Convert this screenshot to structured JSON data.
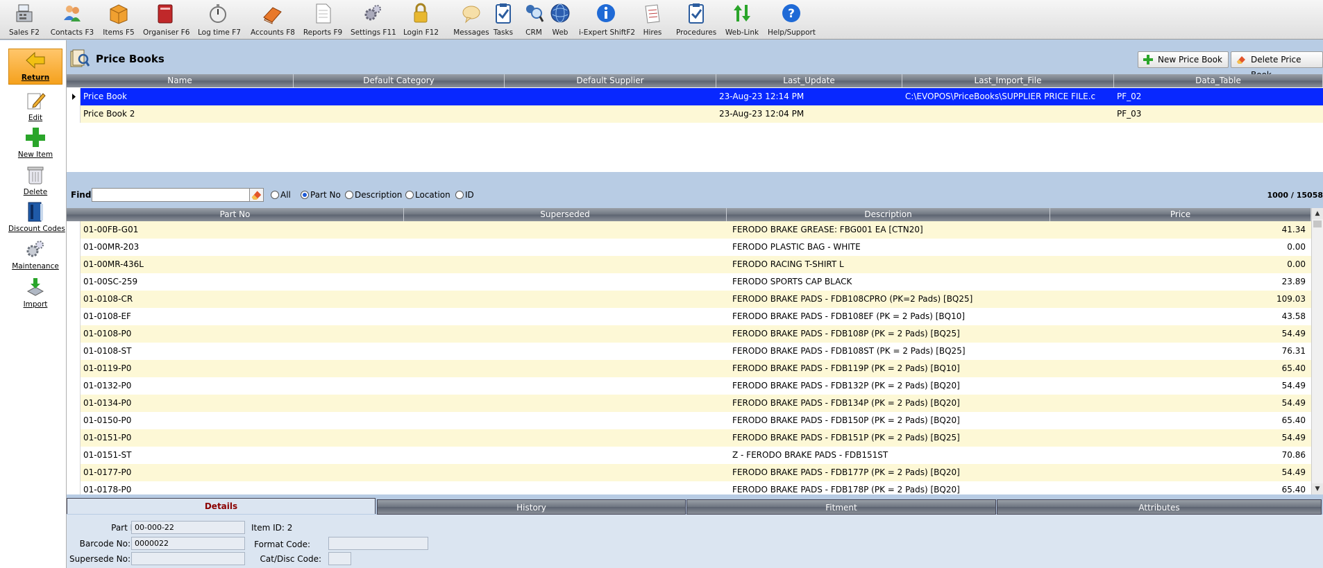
{
  "toolbar": {
    "items": [
      {
        "label": "Sales F2",
        "icon": "cash-register-icon"
      },
      {
        "label": "Contacts F3",
        "icon": "contacts-icon"
      },
      {
        "label": "Items F5",
        "icon": "box-icon"
      },
      {
        "label": "Organiser F6",
        "icon": "organiser-icon"
      },
      {
        "label": "Log time F7",
        "icon": "stopwatch-icon"
      },
      {
        "label": "Accounts F8",
        "icon": "accounts-book-icon"
      },
      {
        "label": "Reports F9",
        "icon": "report-icon"
      },
      {
        "label": "Settings F11",
        "icon": "settings-icon"
      },
      {
        "label": "Login F12",
        "icon": "padlock-icon"
      },
      {
        "label": "Messages",
        "icon": "speech-bubble-icon"
      },
      {
        "label": "Tasks",
        "icon": "clipboard-check-icon"
      },
      {
        "label": "CRM",
        "icon": "crm-search-icon"
      },
      {
        "label": "Web",
        "icon": "globe-icon"
      },
      {
        "label": "i-Expert ShiftF2",
        "icon": "info-icon"
      },
      {
        "label": "Hires",
        "icon": "hires-icon"
      },
      {
        "label": "Procedures",
        "icon": "clipboard-check-icon"
      },
      {
        "label": "Web-Link",
        "icon": "updown-arrows-icon"
      },
      {
        "label": "Help/Support",
        "icon": "help-icon"
      }
    ]
  },
  "sidebar": {
    "items": [
      {
        "label": "Return",
        "icon": "return-arrow-icon"
      },
      {
        "label": "Edit",
        "icon": "edit-icon"
      },
      {
        "label": "New Item",
        "icon": "plus-icon"
      },
      {
        "label": "Delete",
        "icon": "trash-icon"
      },
      {
        "label": "Discount Codes",
        "icon": "discount-book-icon"
      },
      {
        "label": "Maintenance",
        "icon": "gears-icon"
      },
      {
        "label": "Import",
        "icon": "import-icon"
      }
    ]
  },
  "price_books": {
    "title": "Price Books",
    "new_button": "New Price Book",
    "delete_button": "Delete Price Book",
    "columns": [
      "Name",
      "Default Category",
      "Default Supplier",
      "Last_Update",
      "Last_Import_File",
      "Data_Table"
    ],
    "rows": [
      {
        "name": "Price Book",
        "category": "",
        "supplier": "",
        "last_update": "23-Aug-23 12:14 PM",
        "import_file": "C:\\EVOPOS\\PriceBooks\\SUPPLIER PRICE FILE.c",
        "data_table": "PF_02"
      },
      {
        "name": "Price Book 2",
        "category": "",
        "supplier": "",
        "last_update": "23-Aug-23 12:04 PM",
        "import_file": "",
        "data_table": "PF_03"
      }
    ]
  },
  "find": {
    "label": "Find:",
    "value": "",
    "options": [
      "All",
      "Part No",
      "Description",
      "Location",
      "ID"
    ],
    "selected": "Part No",
    "count": "1000 / 15058"
  },
  "items": {
    "columns": [
      "Part No",
      "Superseded",
      "Description",
      "Price"
    ],
    "rows": [
      {
        "part": "01-00FB-G01",
        "superseded": "",
        "desc": "FERODO BRAKE GREASE: FBG001 EA  [CTN20]",
        "price": "41.34"
      },
      {
        "part": "01-00MR-203",
        "superseded": "",
        "desc": "FERODO PLASTIC BAG - WHITE",
        "price": "0.00"
      },
      {
        "part": "01-00MR-436L",
        "superseded": "",
        "desc": "FERODO RACING T-SHIRT L",
        "price": "0.00"
      },
      {
        "part": "01-00SC-259",
        "superseded": "",
        "desc": "FERODO SPORTS CAP BLACK",
        "price": "23.89"
      },
      {
        "part": "01-0108-CR",
        "superseded": "",
        "desc": "FERODO BRAKE PADS - FDB108CPRO (PK=2 Pads) [BQ25]",
        "price": "109.03"
      },
      {
        "part": "01-0108-EF",
        "superseded": "",
        "desc": "FERODO BRAKE PADS - FDB108EF (PK = 2 Pads) [BQ10]",
        "price": "43.58"
      },
      {
        "part": "01-0108-P0",
        "superseded": "",
        "desc": "FERODO BRAKE PADS - FDB108P (PK = 2 Pads) [BQ25]",
        "price": "54.49"
      },
      {
        "part": "01-0108-ST",
        "superseded": "",
        "desc": "FERODO BRAKE PADS - FDB108ST (PK = 2 Pads) [BQ25]",
        "price": "76.31"
      },
      {
        "part": "01-0119-P0",
        "superseded": "",
        "desc": "FERODO BRAKE PADS - FDB119P (PK = 2 Pads) [BQ10]",
        "price": "65.40"
      },
      {
        "part": "01-0132-P0",
        "superseded": "",
        "desc": "FERODO BRAKE PADS - FDB132P (PK = 2 Pads) [BQ20]",
        "price": "54.49"
      },
      {
        "part": "01-0134-P0",
        "superseded": "",
        "desc": "FERODO BRAKE PADS - FDB134P (PK = 2 Pads) [BQ20]",
        "price": "54.49"
      },
      {
        "part": "01-0150-P0",
        "superseded": "",
        "desc": "FERODO BRAKE PADS - FDB150P (PK = 2 Pads) [BQ20]",
        "price": "65.40"
      },
      {
        "part": "01-0151-P0",
        "superseded": "",
        "desc": "FERODO BRAKE PADS - FDB151P (PK = 2 Pads) [BQ25]",
        "price": "54.49"
      },
      {
        "part": "01-0151-ST",
        "superseded": "",
        "desc": "Z - FERODO BRAKE PADS - FDB151ST",
        "price": "70.86"
      },
      {
        "part": "01-0177-P0",
        "superseded": "",
        "desc": "FERODO BRAKE PADS - FDB177P (PK = 2 Pads) [BQ20]",
        "price": "54.49"
      },
      {
        "part": "01-0178-P0",
        "superseded": "",
        "desc": "FERODO BRAKE PADS - FDB178P (PK = 2 Pads) [BQ20]",
        "price": "65.40"
      }
    ]
  },
  "tabs": [
    "Details",
    "History",
    "Fitment",
    "Attributes"
  ],
  "details": {
    "part_no_label": "Part No:",
    "part_no": "00-000-22",
    "item_id": "Item ID: 2",
    "barcode_label": "Barcode No:",
    "barcode": "0000022",
    "format_code_label": "Format Code:",
    "format_code": "",
    "supersede_label": "Supersede No:",
    "supersede": "",
    "cat_disc_label": "Cat/Disc Code:",
    "cat_disc": ""
  }
}
